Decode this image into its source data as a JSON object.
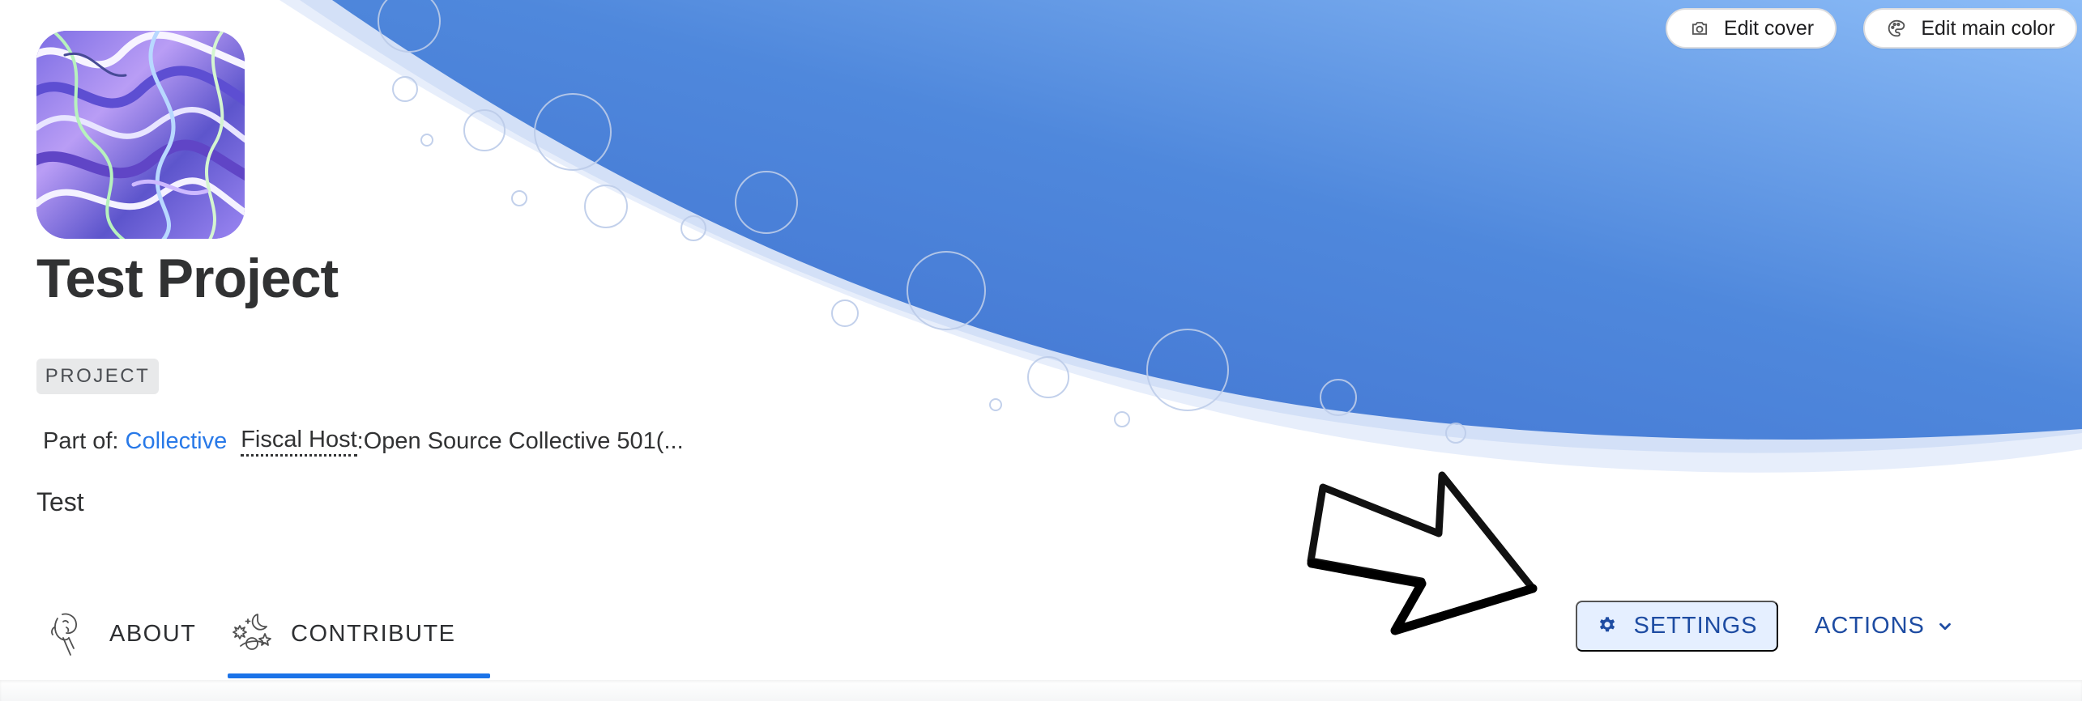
{
  "header_actions": {
    "edit_cover": "Edit cover",
    "edit_main_color": "Edit main color"
  },
  "profile": {
    "name": "Test Project",
    "type_badge": "PROJECT",
    "part_of_label": "Part of:",
    "parent_collective": "Collective",
    "fiscal_host_label": "Fiscal Host",
    "fiscal_host_separator": ":",
    "fiscal_host_name": " Open Source Collective 501(...",
    "description": "Test"
  },
  "tabs": [
    {
      "label": "ABOUT",
      "icon": "about-icon"
    },
    {
      "label": "CONTRIBUTE",
      "icon": "contribute-icon"
    }
  ],
  "buttons": {
    "settings": "SETTINGS",
    "actions": "ACTIONS"
  },
  "colors": {
    "cover_start": "#4a7ad1",
    "cover_end": "#89b8f5",
    "active_tab": "#1b73e8",
    "action_blue": "#1e4ca2",
    "link_blue": "#2879e8"
  }
}
